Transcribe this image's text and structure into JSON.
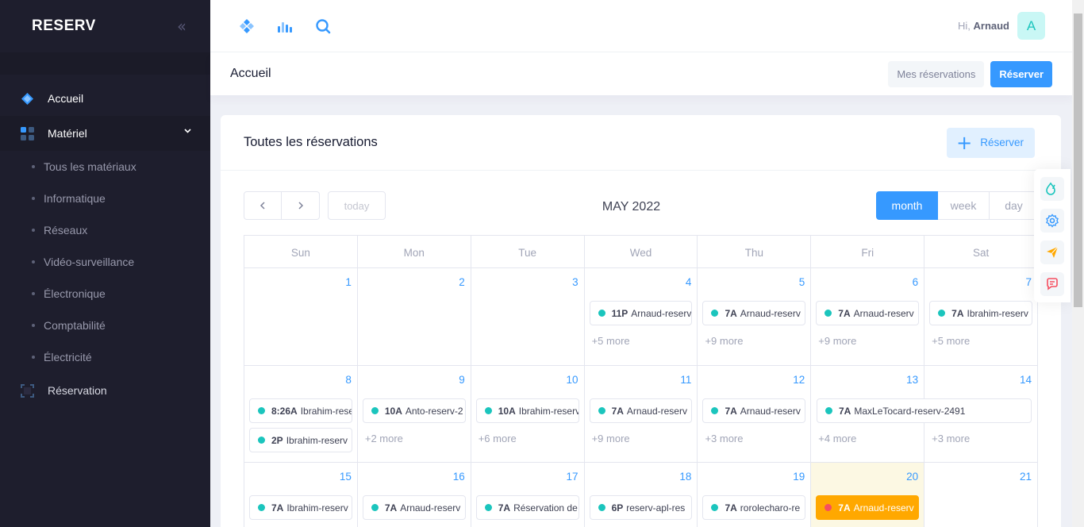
{
  "app": {
    "brand": "RESERV"
  },
  "sidebar": {
    "items": [
      {
        "label": "Accueil"
      },
      {
        "label": "Matériel"
      },
      {
        "label": "Réservation"
      }
    ],
    "subitems": [
      "Tous les matériaux",
      "Informatique",
      "Réseaux",
      "Vidéo-surveillance",
      "Électronique",
      "Comptabilité",
      "Électricité"
    ]
  },
  "header": {
    "greeting": "Hi,",
    "user_name": "Arnaud",
    "avatar_letter": "A"
  },
  "subheader": {
    "title": "Accueil",
    "my_reservations_label": "Mes réservations",
    "reserve_label": "Réserver"
  },
  "card": {
    "title": "Toutes les réservations",
    "reserve_label": "Réserver"
  },
  "calendar": {
    "title": "MAY 2022",
    "today_label": "today",
    "views": {
      "month": "month",
      "week": "week",
      "day": "day"
    },
    "weekdays": [
      "Sun",
      "Mon",
      "Tue",
      "Wed",
      "Thu",
      "Fri",
      "Sat"
    ],
    "weeks": [
      {
        "days": [
          {
            "num": "1",
            "events": [],
            "more": ""
          },
          {
            "num": "2",
            "events": [],
            "more": ""
          },
          {
            "num": "3",
            "events": [],
            "more": ""
          },
          {
            "num": "4",
            "events": [
              {
                "time": "11P",
                "title": "Arnaud-reserv"
              }
            ],
            "more": "+5 more"
          },
          {
            "num": "5",
            "events": [
              {
                "time": "7A",
                "title": "Arnaud-reserv"
              }
            ],
            "more": "+9 more"
          },
          {
            "num": "6",
            "events": [
              {
                "time": "7A",
                "title": "Arnaud-reserv"
              }
            ],
            "more": "+9 more"
          },
          {
            "num": "7",
            "events": [
              {
                "time": "7A",
                "title": "Ibrahim-reserv"
              }
            ],
            "more": "+5 more"
          }
        ]
      },
      {
        "days": [
          {
            "num": "8",
            "events": [
              {
                "time": "8:26A",
                "title": "Ibrahim-reserv"
              },
              {
                "time": "2P",
                "title": "Ibrahim-reserv"
              }
            ],
            "more": ""
          },
          {
            "num": "9",
            "events": [
              {
                "time": "10A",
                "title": "Anto-reserv-2"
              }
            ],
            "more": "+2 more"
          },
          {
            "num": "10",
            "events": [
              {
                "time": "10A",
                "title": "Ibrahim-reserv"
              }
            ],
            "more": "+6 more"
          },
          {
            "num": "11",
            "events": [
              {
                "time": "7A",
                "title": "Arnaud-reserv"
              }
            ],
            "more": "+9 more"
          },
          {
            "num": "12",
            "events": [
              {
                "time": "7A",
                "title": "Arnaud-reserv"
              }
            ],
            "more": "+3 more"
          },
          {
            "num": "13",
            "events": [
              {
                "time": "7A",
                "title": "MaxLeTocard-reserv-2491"
              }
            ],
            "more": "+4 more"
          },
          {
            "num": "14",
            "events": [],
            "more": "+3 more"
          }
        ]
      },
      {
        "days": [
          {
            "num": "15",
            "events": [
              {
                "time": "7A",
                "title": "Ibrahim-reserv"
              }
            ],
            "more": ""
          },
          {
            "num": "16",
            "events": [
              {
                "time": "7A",
                "title": "Arnaud-reserv"
              }
            ],
            "more": ""
          },
          {
            "num": "17",
            "events": [
              {
                "time": "7A",
                "title": "Réservation de"
              }
            ],
            "more": ""
          },
          {
            "num": "18",
            "events": [
              {
                "time": "6P",
                "title": "reserv-apl-res"
              }
            ],
            "more": ""
          },
          {
            "num": "19",
            "events": [
              {
                "time": "7A",
                "title": "rorolecharo-re"
              }
            ],
            "more": ""
          },
          {
            "num": "20",
            "events": [
              {
                "time": "7A",
                "title": "Arnaud-reserv",
                "highlight": true
              }
            ],
            "more": "",
            "today": true
          },
          {
            "num": "21",
            "events": [],
            "more": ""
          }
        ]
      }
    ]
  },
  "colors": {
    "primary": "#3699ff",
    "sidebar_bg": "#1e1e2d",
    "event_dot": "#1bc5bd",
    "today_bg": "#fcf8e3",
    "highlight_event": "#ffa800"
  },
  "float_toolbar": {
    "icons": [
      "drops-icon",
      "gear-icon",
      "paper-plane-icon",
      "chat-icon"
    ]
  }
}
